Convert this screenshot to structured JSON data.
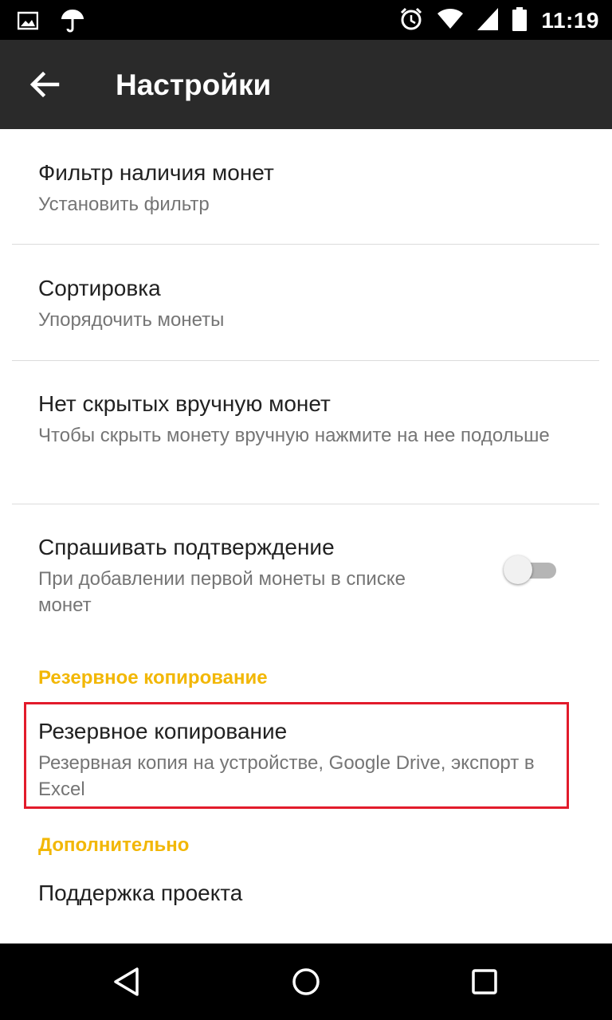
{
  "status_bar": {
    "time": "11:19",
    "left_icons": [
      "image-icon",
      "umbrella-icon"
    ],
    "right_icons": [
      "alarm-icon",
      "wifi-icon",
      "signal-icon",
      "battery-icon"
    ]
  },
  "appbar": {
    "title": "Настройки",
    "back_icon": "arrow-back-icon"
  },
  "settings": [
    {
      "title": "Фильтр наличия монет",
      "subtitle": "Установить фильтр"
    },
    {
      "title": "Сортировка",
      "subtitle": "Упорядочить монеты"
    },
    {
      "title": "Нет скрытых вручную монет",
      "subtitle": "Чтобы скрыть монету вручную нажмите на нее подольше"
    },
    {
      "title": "Спрашивать подтверждение",
      "subtitle": "При добавлении первой монеты в списке монет",
      "toggle_on": false
    }
  ],
  "sections": {
    "backup_header": "Резервное копирование",
    "backup_item": {
      "title": "Резервное копирование",
      "subtitle": "Резервная копия на устройстве, Google Drive, экспорт в Excel"
    },
    "extra_header": "Дополнительно",
    "extra_item_partial": "Поддержка проекта"
  },
  "colors": {
    "accent": "#f2b705",
    "appbar": "#2a2a2a",
    "highlight": "#e21b2b"
  },
  "navbar_icons": [
    "back-triangle-icon",
    "home-circle-icon",
    "recents-square-icon"
  ]
}
